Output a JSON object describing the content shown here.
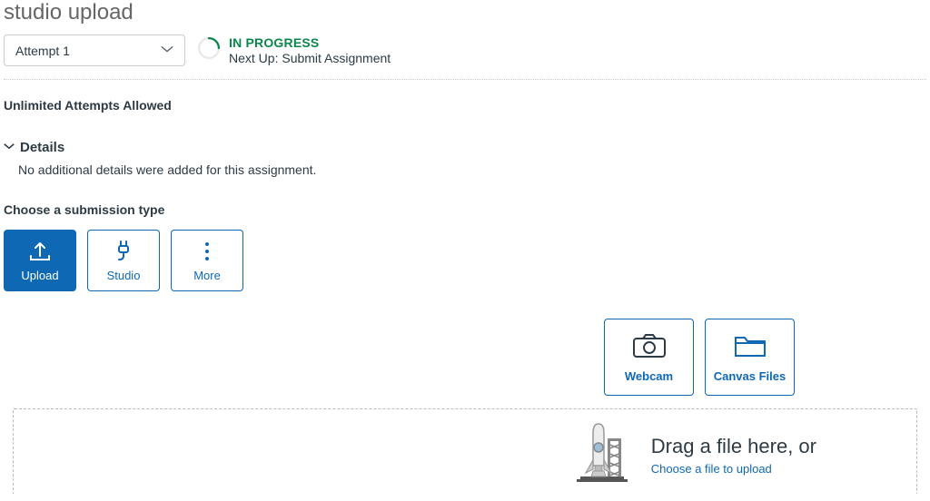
{
  "page": {
    "title": "studio upload"
  },
  "attempt": {
    "selected": "Attempt 1"
  },
  "status": {
    "label": "IN PROGRESS",
    "next_up": "Next Up: Submit Assignment"
  },
  "attempts_allowed": "Unlimited Attempts Allowed",
  "details": {
    "header": "Details",
    "body": "No additional details were added for this assignment."
  },
  "submission": {
    "label": "Choose a submission type",
    "types": {
      "upload": "Upload",
      "studio": "Studio",
      "more": "More"
    }
  },
  "upload_sources": {
    "webcam": "Webcam",
    "canvas_files": "Canvas Files"
  },
  "dropzone": {
    "drag_label": "Drag a file here, or",
    "choose_label": "Choose a file to upload"
  }
}
